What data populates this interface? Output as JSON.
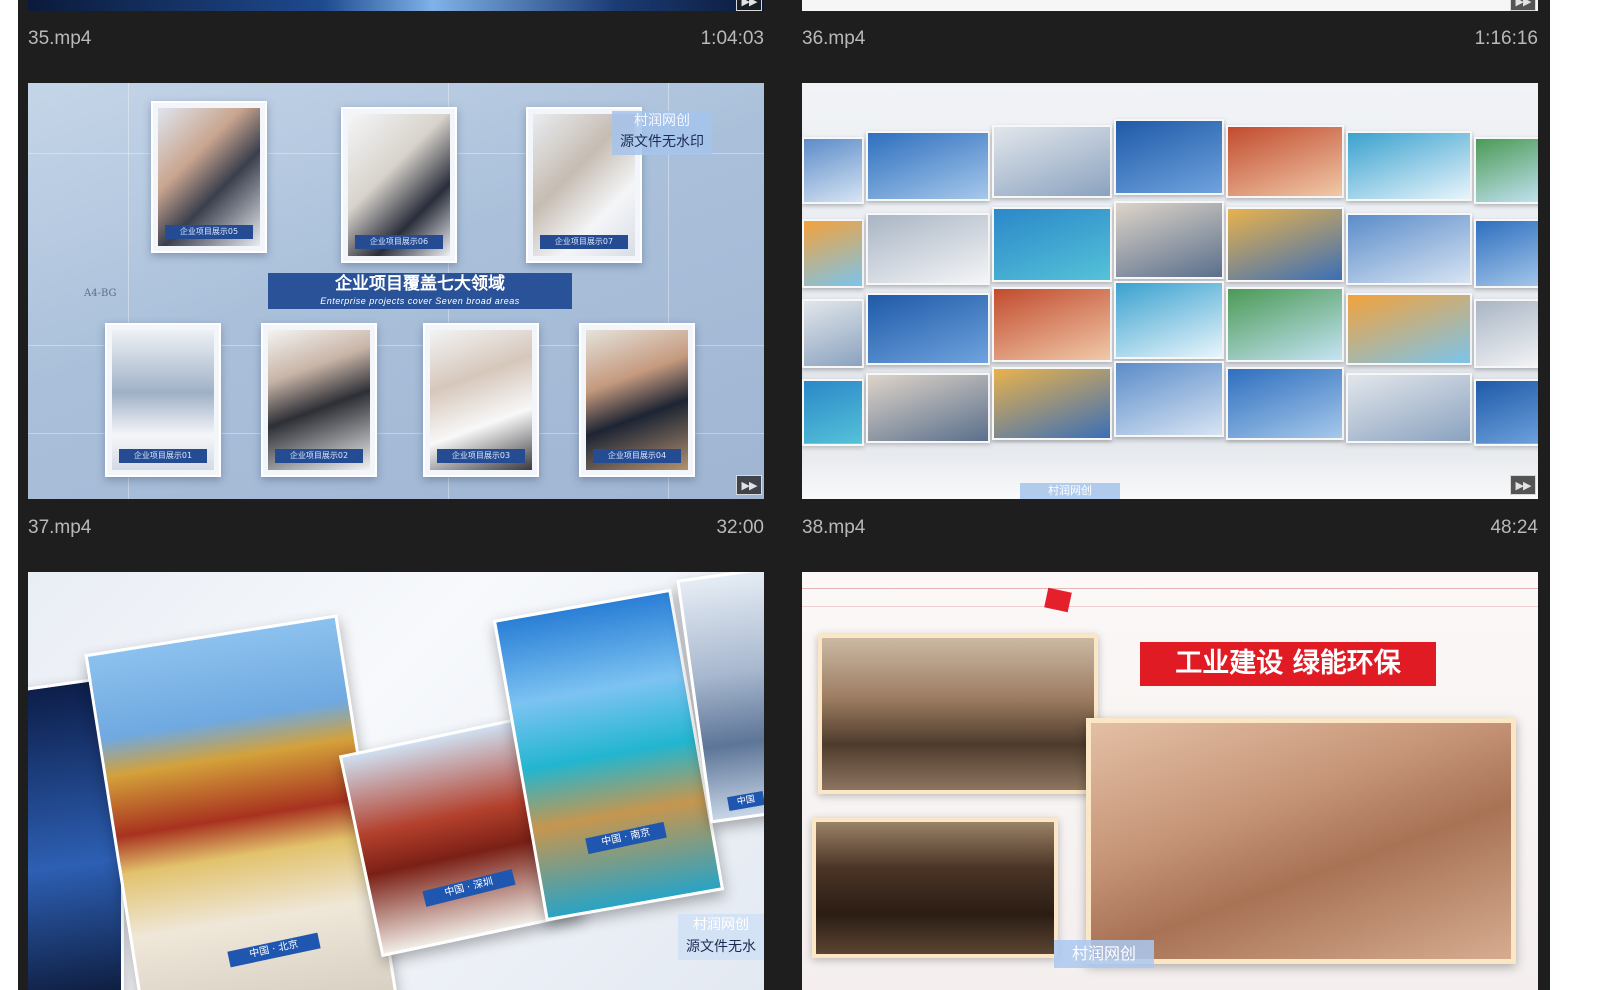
{
  "videos": [
    {
      "name": "35.mp4",
      "duration": "1:04:03"
    },
    {
      "name": "36.mp4",
      "duration": "1:16:16"
    },
    {
      "name": "37.mp4",
      "duration": "32:00"
    },
    {
      "name": "38.mp4",
      "duration": "48:24"
    }
  ],
  "thumb37": {
    "banner_cn": "企业项目覆盖七大领域",
    "banner_en": "Enterprise projects cover Seven broad areas",
    "watermark_line1": "村润网创",
    "watermark_line2": "源文件无水印",
    "corner_label": "A4-BG",
    "tags": [
      "企业项目展示05",
      "企业项目展示06",
      "企业项目展示07",
      "企业项目展示01",
      "企业项目展示02",
      "企业项目展示03",
      "企业项目展示04"
    ]
  },
  "thumb39": {
    "tag1": "中国 · 北京",
    "tag2": "中国 · 深圳",
    "tag3": "中国 · 南京",
    "tag4": "中国",
    "watermark_line1": "村润网创",
    "watermark_line2": "源文件无水"
  },
  "thumb40": {
    "headline": "工业建设 绿能环保",
    "watermark": "村润网创"
  },
  "icons": {
    "play": "play-frames-icon"
  }
}
